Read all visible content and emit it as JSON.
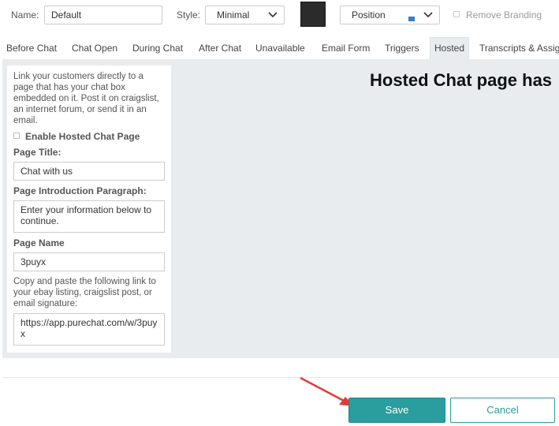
{
  "toolbar": {
    "name_label": "Name:",
    "name_value": "Default",
    "style_label": "Style:",
    "style_value": "Minimal",
    "color_swatch": "#2b2b2b",
    "position_value": "Position",
    "remove_branding_label": "Remove Branding"
  },
  "tabs": [
    {
      "label": "Before Chat"
    },
    {
      "label": "Chat Open"
    },
    {
      "label": "During Chat"
    },
    {
      "label": "After Chat"
    },
    {
      "label": "Unavailable"
    },
    {
      "label": "Email Form"
    },
    {
      "label": "Triggers"
    },
    {
      "label": "Hosted",
      "active": true
    },
    {
      "label": "Transcripts & Assig"
    }
  ],
  "hosted_form": {
    "intro_text": "Link your customers directly to a page that has your chat box embedded on it. Post it on craigslist, an internet forum, or send it in an email.",
    "enable_label": "Enable Hosted Chat Page",
    "page_title_label": "Page Title:",
    "page_title_value": "Chat with us",
    "intro_para_label": "Page Introduction Paragraph:",
    "intro_para_value": "Enter your information below to continue.",
    "page_name_label": "Page Name",
    "page_name_value": "3puyx",
    "copy_hint": "Copy and paste the following link to your ebay listing, craigslist post, or email signature:",
    "link_value": "https://app.purechat.com/w/3puyx"
  },
  "preview": {
    "title": "Hosted Chat page has"
  },
  "footer": {
    "save_label": "Save",
    "cancel_label": "Cancel"
  },
  "colors": {
    "accent": "#2a9d9e",
    "panel_bg": "#e8ecee",
    "annotation_arrow": "#e53935"
  }
}
